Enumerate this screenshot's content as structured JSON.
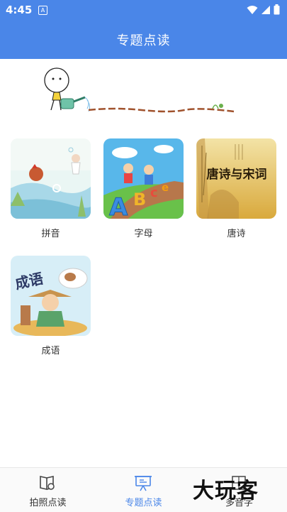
{
  "status": {
    "time": "4:45",
    "notification_glyph": "A"
  },
  "appbar": {
    "title": "专题点读"
  },
  "topics": [
    {
      "label": "拼音"
    },
    {
      "label": "字母"
    },
    {
      "label": "唐诗",
      "cover_text": "唐诗与宋词"
    },
    {
      "label": "成语",
      "cover_text": "成语"
    }
  ],
  "nav": {
    "items": [
      {
        "label": "拍照点读",
        "icon": "book-camera-icon",
        "active": false
      },
      {
        "label": "专题点读",
        "icon": "presentation-board-icon",
        "active": true
      },
      {
        "label": "多音字",
        "icon": "grid-icon",
        "active": false
      }
    ],
    "active_color": "#4a86e8",
    "inactive_color": "#333333"
  },
  "watermark": "大玩客"
}
